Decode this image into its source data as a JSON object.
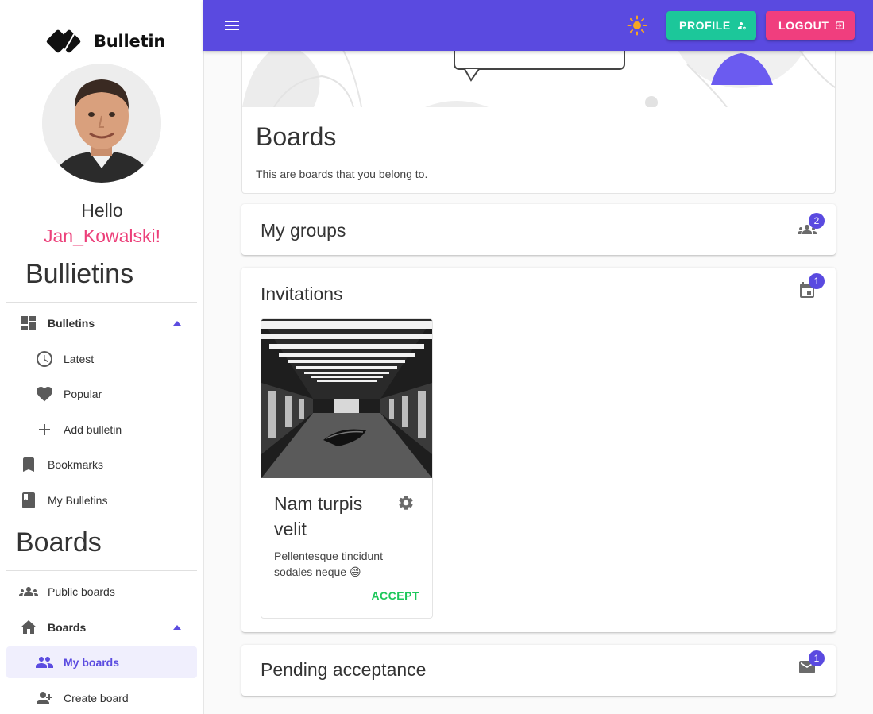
{
  "brand": {
    "name": "Bulletin"
  },
  "user": {
    "greeting": "Hello",
    "username": "Jan_Kowalski!"
  },
  "sidebar": {
    "bulletins_title": "Bullietins",
    "boards_title": "Boards",
    "items": [
      {
        "label": "Bulletins",
        "icon": "dashboard-icon"
      },
      {
        "label": "Latest",
        "icon": "clock-icon"
      },
      {
        "label": "Popular",
        "icon": "heart-icon"
      },
      {
        "label": "Add bulletin",
        "icon": "plus-icon"
      },
      {
        "label": "Bookmarks",
        "icon": "bookmark-icon"
      },
      {
        "label": "My Bulletins",
        "icon": "book-icon"
      },
      {
        "label": "Public boards",
        "icon": "groups-icon"
      },
      {
        "label": "Boards",
        "icon": "home-icon"
      },
      {
        "label": "My boards",
        "icon": "people-icon"
      },
      {
        "label": "Create board",
        "icon": "person-add-icon"
      }
    ]
  },
  "topbar": {
    "profile_label": "PROFILE",
    "logout_label": "LOGOUT"
  },
  "main": {
    "hero_title": "Boards",
    "hero_desc": "This are boards that you belong to.",
    "groups": {
      "title": "My groups",
      "count": "2"
    },
    "invitations": {
      "title": "Invitations",
      "count": "1",
      "card": {
        "title": "Nam turpis velit",
        "desc": "Pellentesque tincidunt sodales neque 😄",
        "accept_label": "ACCEPT"
      }
    },
    "pending": {
      "title": "Pending acceptance",
      "count": "1"
    }
  },
  "colors": {
    "primary": "#5a4ae0",
    "profile": "#1cc79a",
    "logout": "#f03e7e",
    "username": "#ec407a",
    "accept": "#1cc75a"
  }
}
